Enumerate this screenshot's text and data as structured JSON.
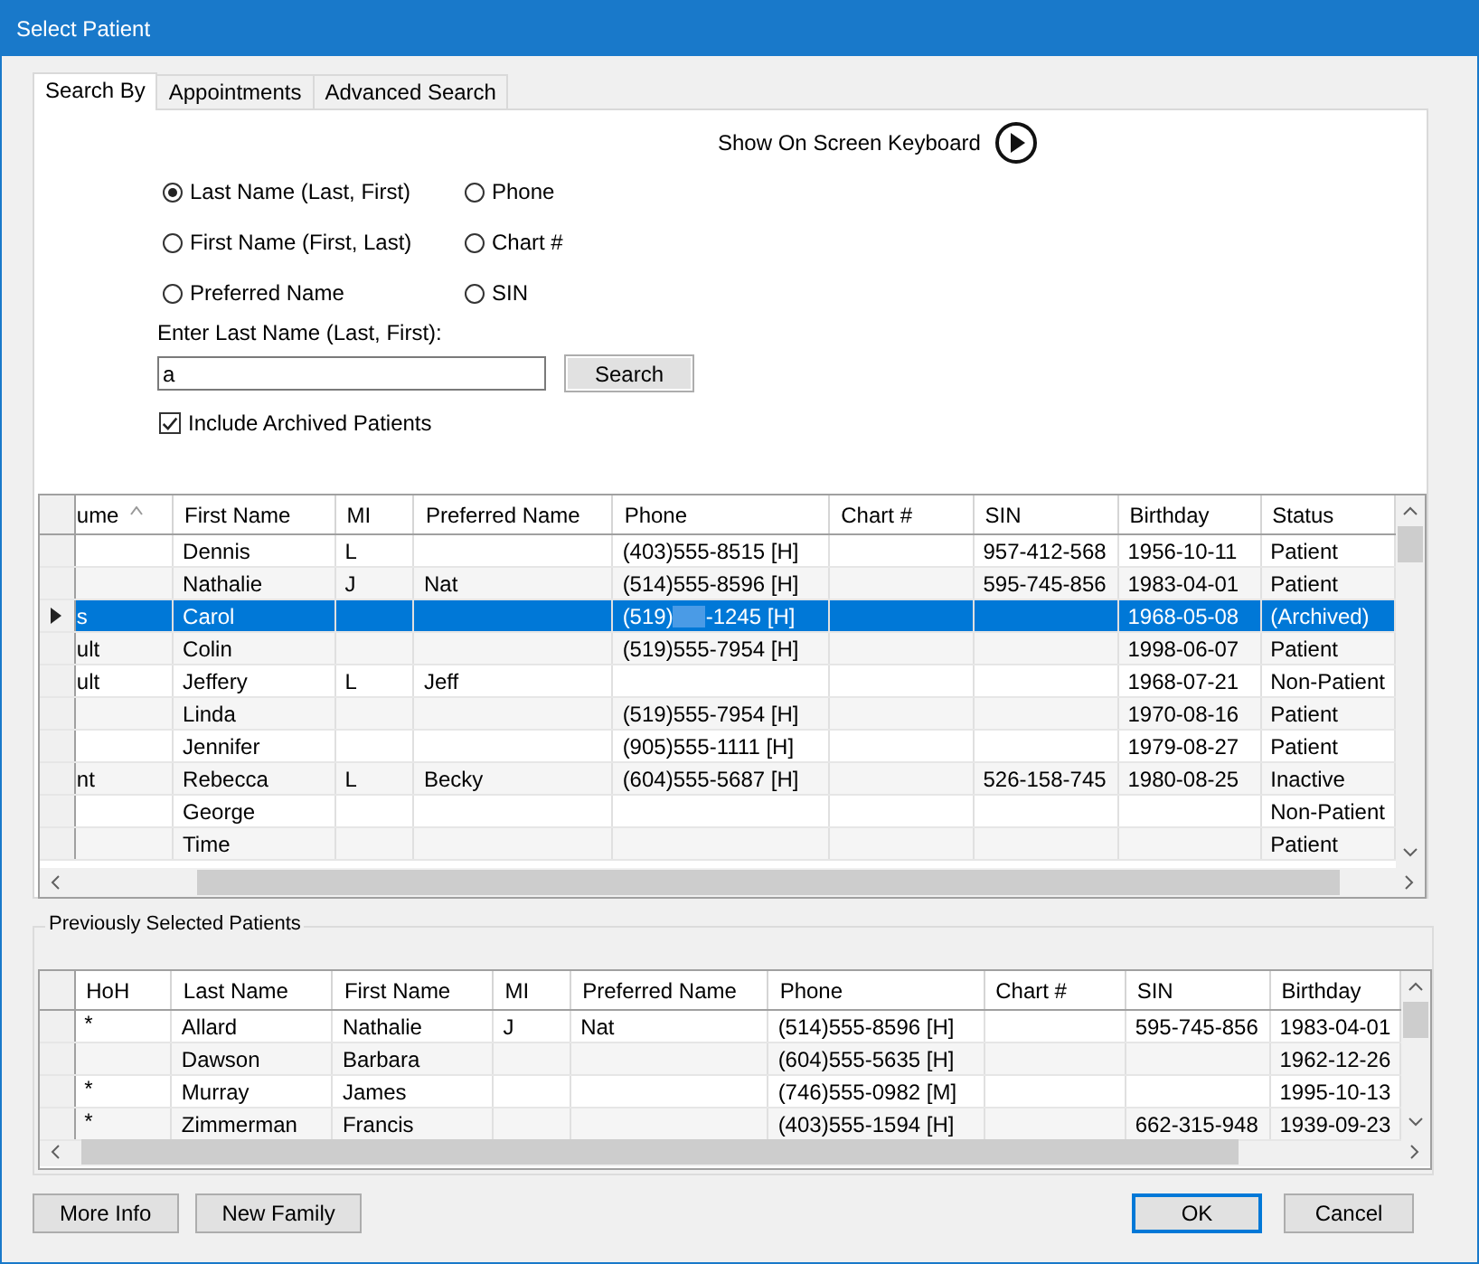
{
  "window": {
    "title": "Select Patient"
  },
  "tabs": [
    {
      "label": "Search By",
      "selected": true
    },
    {
      "label": "Appointments",
      "selected": false
    },
    {
      "label": "Advanced Search",
      "selected": false
    }
  ],
  "keyboard_toggle": {
    "label": "Show On Screen Keyboard"
  },
  "search_options": [
    {
      "label": "Last Name (Last, First)",
      "selected": true
    },
    {
      "label": "Phone",
      "selected": false
    },
    {
      "label": "First Name (First, Last)",
      "selected": false
    },
    {
      "label": "Chart #",
      "selected": false
    },
    {
      "label": "Preferred Name",
      "selected": false
    },
    {
      "label": "SIN",
      "selected": false
    }
  ],
  "search_field": {
    "label": "Enter Last Name (Last, First):",
    "value": "a"
  },
  "search_button": "Search",
  "include_archived": {
    "label": "Include Archived Patients",
    "checked": true
  },
  "results": {
    "columns": [
      {
        "label": "ume",
        "sorted": true
      },
      {
        "label": "First Name",
        "sorted": false
      },
      {
        "label": "MI",
        "sorted": false
      },
      {
        "label": "Preferred Name",
        "sorted": false
      },
      {
        "label": "Phone",
        "sorted": false
      },
      {
        "label": "Chart #",
        "sorted": false
      },
      {
        "label": "SIN",
        "sorted": false
      },
      {
        "label": "Birthday",
        "sorted": false
      },
      {
        "label": "Status",
        "sorted": false
      }
    ],
    "rows": [
      {
        "selected": false,
        "first_name": "Dennis",
        "mi": "L",
        "phone": "(403)555-8515 [H]",
        "sin": "957-412-568",
        "birthday": "1956-10-11",
        "status": "Patient"
      },
      {
        "selected": false,
        "first_name": "Nathalie",
        "mi": "J",
        "preferred_name": "Nat",
        "phone": "(514)555-8596 [H]",
        "sin": "595-745-856",
        "birthday": "1983-04-01",
        "status": "Patient"
      },
      {
        "selected": true,
        "column_1": "s",
        "first_name": "Carol",
        "phone_redacted": {
          "before": "(519)",
          "after": "-1245 [H]"
        },
        "birthday": "1968-05-08",
        "status": "(Archived)"
      },
      {
        "selected": false,
        "column_1": "ult",
        "first_name": "Colin",
        "phone": "(519)555-7954 [H]",
        "birthday": "1998-06-07",
        "status": "Patient"
      },
      {
        "selected": false,
        "column_1": "ult",
        "first_name": "Jeffery",
        "mi": "L",
        "preferred_name": "Jeff",
        "birthday": "1968-07-21",
        "status": "Non-Patient"
      },
      {
        "selected": false,
        "first_name": "Linda",
        "phone": "(519)555-7954 [H]",
        "birthday": "1970-08-16",
        "status": "Patient"
      },
      {
        "selected": false,
        "first_name": "Jennifer",
        "phone": "(905)555-1111 [H]",
        "birthday": "1979-08-27",
        "status": "Patient"
      },
      {
        "selected": false,
        "column_1": "nt",
        "first_name": "Rebecca",
        "mi": "L",
        "preferred_name": "Becky",
        "phone": "(604)555-5687 [H]",
        "sin": "526-158-745",
        "birthday": "1980-08-25",
        "status": "Inactive"
      },
      {
        "selected": false,
        "first_name": "George",
        "status": "Non-Patient"
      },
      {
        "selected": false,
        "first_name": "Time",
        "status": "Patient"
      }
    ]
  },
  "previous": {
    "title": "Previously Selected Patients",
    "columns": [
      "HoH",
      "Last Name",
      "First Name",
      "MI",
      "Preferred Name",
      "Phone",
      "Chart #",
      "SIN",
      "Birthday"
    ],
    "rows": [
      {
        "hoh": "*",
        "last_name": "Allard",
        "first_name": "Nathalie",
        "mi": "J",
        "preferred_name": "Nat",
        "phone": "(514)555-8596 [H]",
        "sin": "595-745-856",
        "birthday": "1983-04-01"
      },
      {
        "last_name": "Dawson",
        "first_name": "Barbara",
        "phone": "(604)555-5635 [H]",
        "birthday": "1962-12-26"
      },
      {
        "hoh": "*",
        "last_name": "Murray",
        "first_name": "James",
        "phone": "(746)555-0982 [M]",
        "birthday": "1995-10-13"
      },
      {
        "hoh": "*",
        "last_name": "Zimmerman",
        "first_name": "Francis",
        "phone": "(403)555-1594 [H]",
        "sin": "662-315-948",
        "birthday": "1939-09-23"
      }
    ]
  },
  "buttons": [
    {
      "label": "More Info",
      "kind": "secondary"
    },
    {
      "label": "New Family",
      "kind": "secondary"
    },
    {
      "label": "OK",
      "kind": "default"
    },
    {
      "label": "Cancel",
      "kind": "secondary"
    }
  ]
}
